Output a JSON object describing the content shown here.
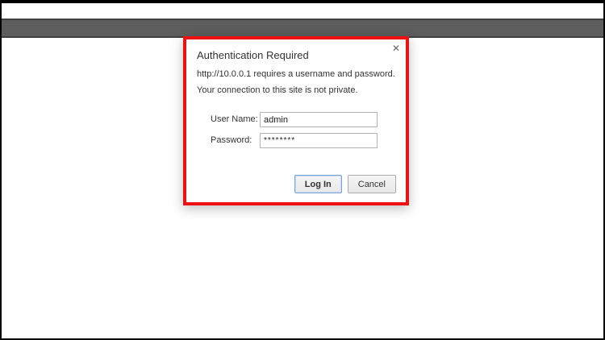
{
  "window": {
    "toolbar_color": "#5d5d5d",
    "frame_color": "#000000"
  },
  "dialog": {
    "title": "Authentication Required",
    "close_glyph": "✕",
    "message_line1": "http://10.0.0.1 requires a username and password.",
    "message_line2": "Your connection to this site is not private.",
    "fields": {
      "username": {
        "label": "User Name:",
        "value": "admin"
      },
      "password": {
        "label": "Password:",
        "value": "********"
      }
    },
    "buttons": {
      "login": "Log In",
      "cancel": "Cancel"
    },
    "highlight_border_color": "#ee1111",
    "login_focus_border_color": "#7ca3d6"
  }
}
